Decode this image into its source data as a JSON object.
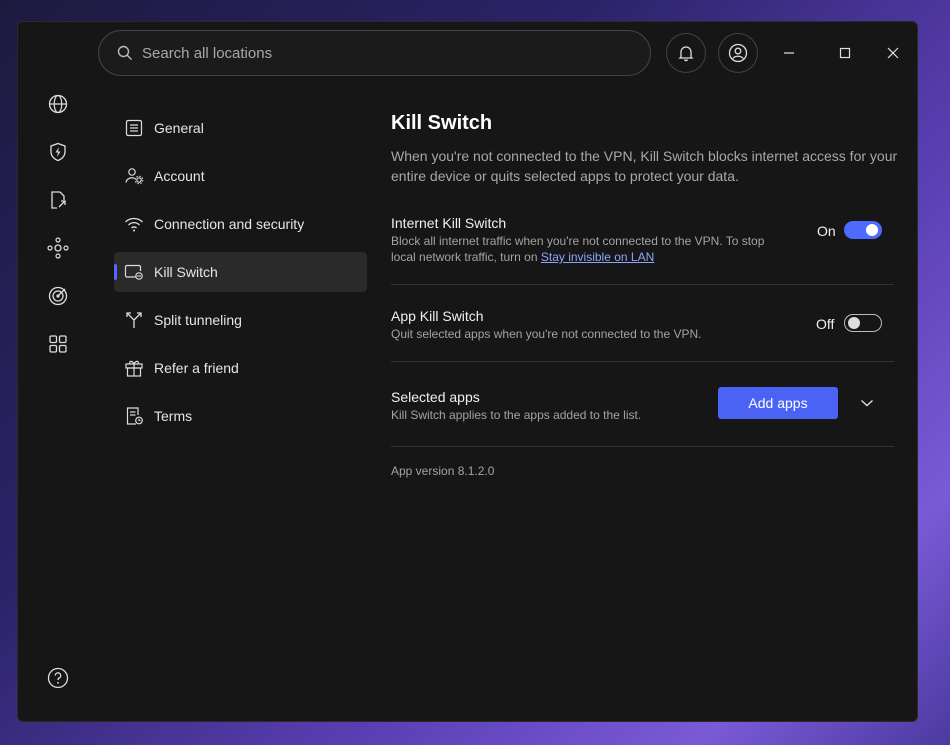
{
  "search": {
    "placeholder": "Search all locations"
  },
  "topbar": {
    "icons": [
      "bell-icon",
      "account-circle-icon"
    ],
    "window_controls": [
      "minimize-icon",
      "maximize-icon",
      "close-icon"
    ]
  },
  "rail": {
    "icons": [
      "globe-icon",
      "shield-bolt-icon",
      "file-share-icon",
      "mesh-network-icon",
      "target-radar-icon",
      "apps-grid-icon",
      "help-icon"
    ]
  },
  "nav": {
    "items": [
      {
        "label": "General",
        "icon": "sliders-icon"
      },
      {
        "label": "Account",
        "icon": "account-gear-icon"
      },
      {
        "label": "Connection and security",
        "icon": "wifi-icon"
      },
      {
        "label": "Kill Switch",
        "icon": "kill-switch-icon",
        "active": true
      },
      {
        "label": "Split tunneling",
        "icon": "split-icon"
      },
      {
        "label": "Refer a friend",
        "icon": "gift-icon"
      },
      {
        "label": "Terms",
        "icon": "document-icon"
      }
    ]
  },
  "main": {
    "title": "Kill Switch",
    "description": "When you're not connected to the VPN, Kill Switch blocks internet access for your entire device or quits selected apps to protect your data.",
    "internet_kill_switch": {
      "title": "Internet Kill Switch",
      "subtitle_prefix": "Block all internet traffic when you're not connected to the VPN. To stop local network traffic, turn on ",
      "link": "Stay invisible on LAN",
      "state_label": "On",
      "state": true
    },
    "app_kill_switch": {
      "title": "App Kill Switch",
      "subtitle": "Quit selected apps when you're not connected to the VPN.",
      "state_label": "Off",
      "state": false
    },
    "selected_apps": {
      "title": "Selected apps",
      "subtitle": "Kill Switch applies to the apps added to the list.",
      "button": "Add apps"
    },
    "version": "App version 8.1.2.0"
  },
  "colors": {
    "accent": "#4d6bff",
    "background": "#161616",
    "button": "#4a63f5",
    "link": "#8ea4ff"
  }
}
